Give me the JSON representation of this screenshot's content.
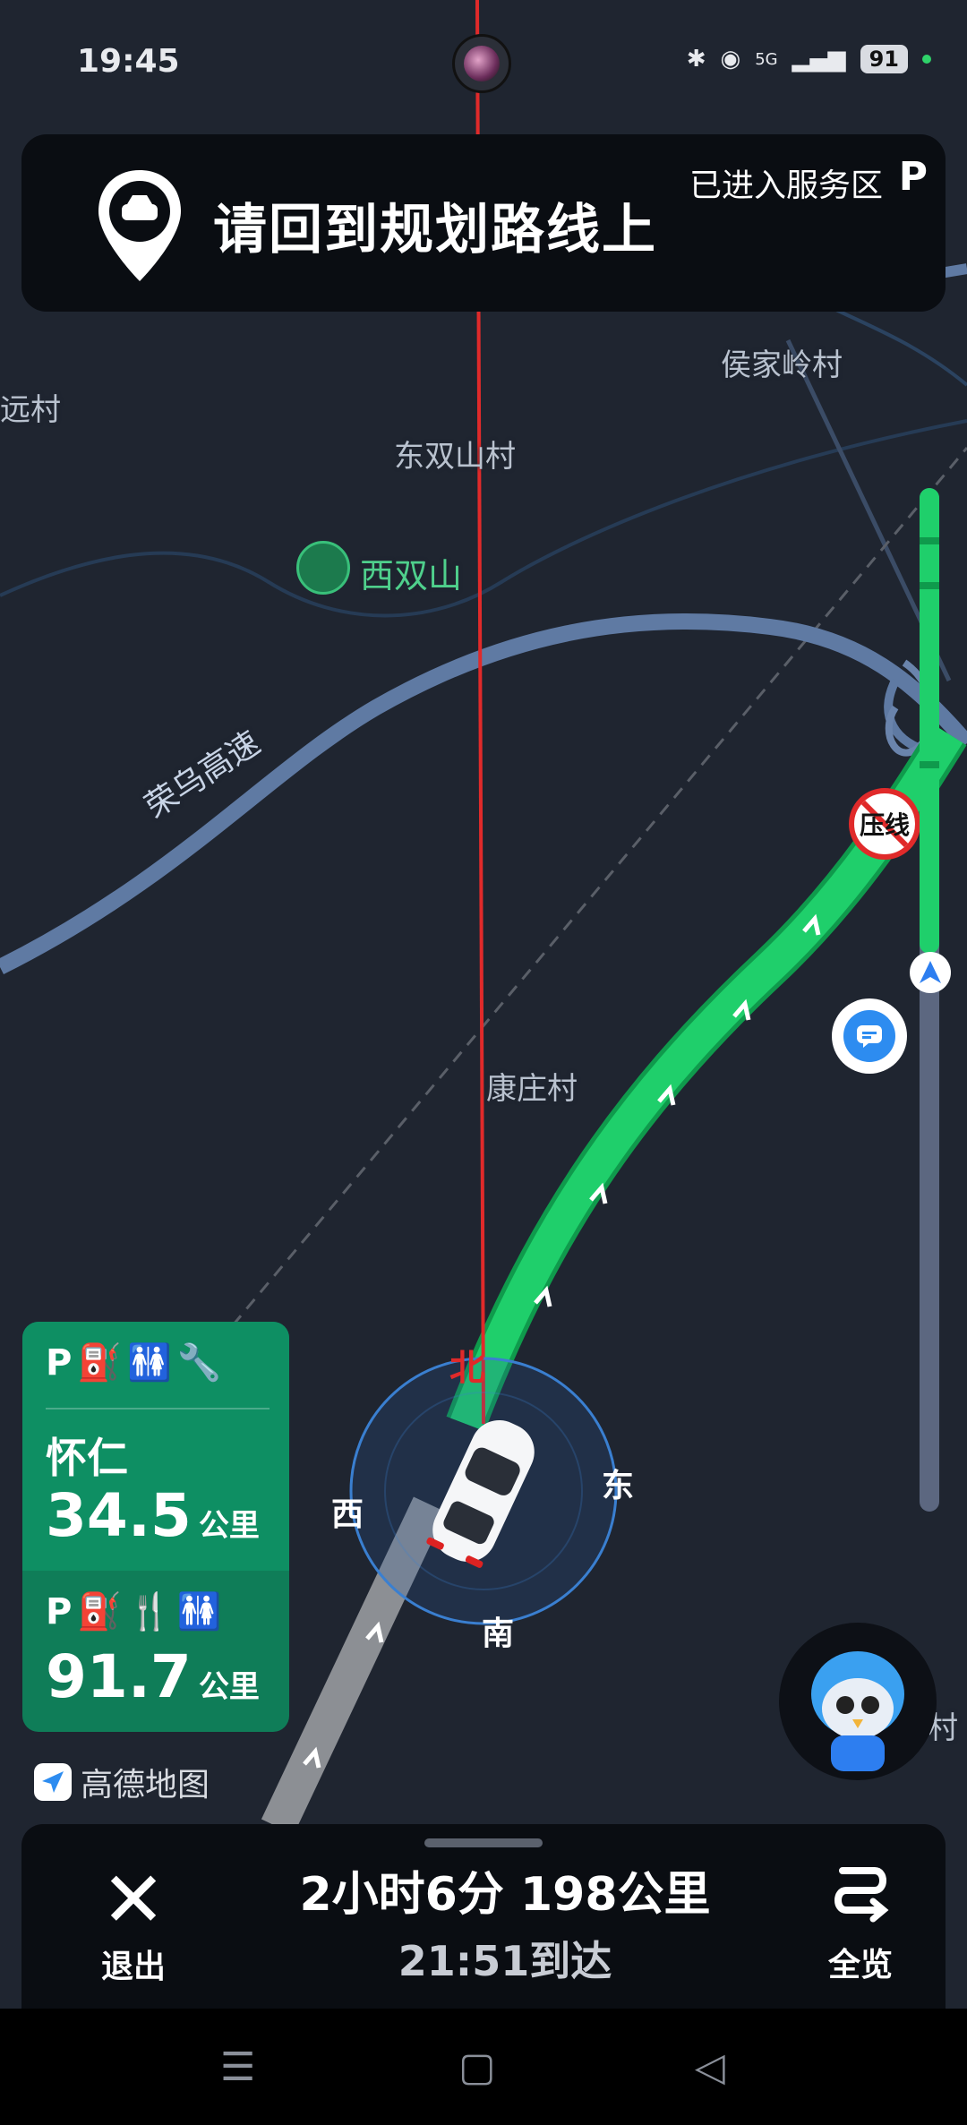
{
  "status_bar": {
    "time": "19:45",
    "battery": "91",
    "signal": "5G"
  },
  "banner": {
    "message": "请回到规划路线上",
    "service_status": "已进入服务区",
    "service_icon": "P"
  },
  "map": {
    "labels": {
      "village_left": "远村",
      "houjialing": "侯家岭村",
      "dongshuangshan": "东双山村",
      "xishuangshan": "西双山",
      "rongwu": "荣乌高速",
      "kangzhuang": "康庄村",
      "right_edge": "村"
    },
    "no_lane_sign": "压线",
    "compass": {
      "north": "北",
      "south": "南",
      "east": "东",
      "west": "西"
    }
  },
  "service_cards": [
    {
      "icons": "P⛽🚻🔧",
      "name": "怀仁",
      "distance": "34.5",
      "unit": "公里"
    },
    {
      "icons": "P⛽🍴🚻",
      "distance": "91.7",
      "unit": "公里"
    }
  ],
  "brand": {
    "name": "高德地图"
  },
  "bottom": {
    "exit_label": "退出",
    "duration_distance": "2小时6分  198公里",
    "arrival": "21:51到达",
    "overview_label": "全览"
  },
  "colors": {
    "route": "#1fcf6b",
    "map_bg": "#1f2530",
    "service_card": "#0e8f63",
    "deviation_line": "#e02a2a"
  }
}
